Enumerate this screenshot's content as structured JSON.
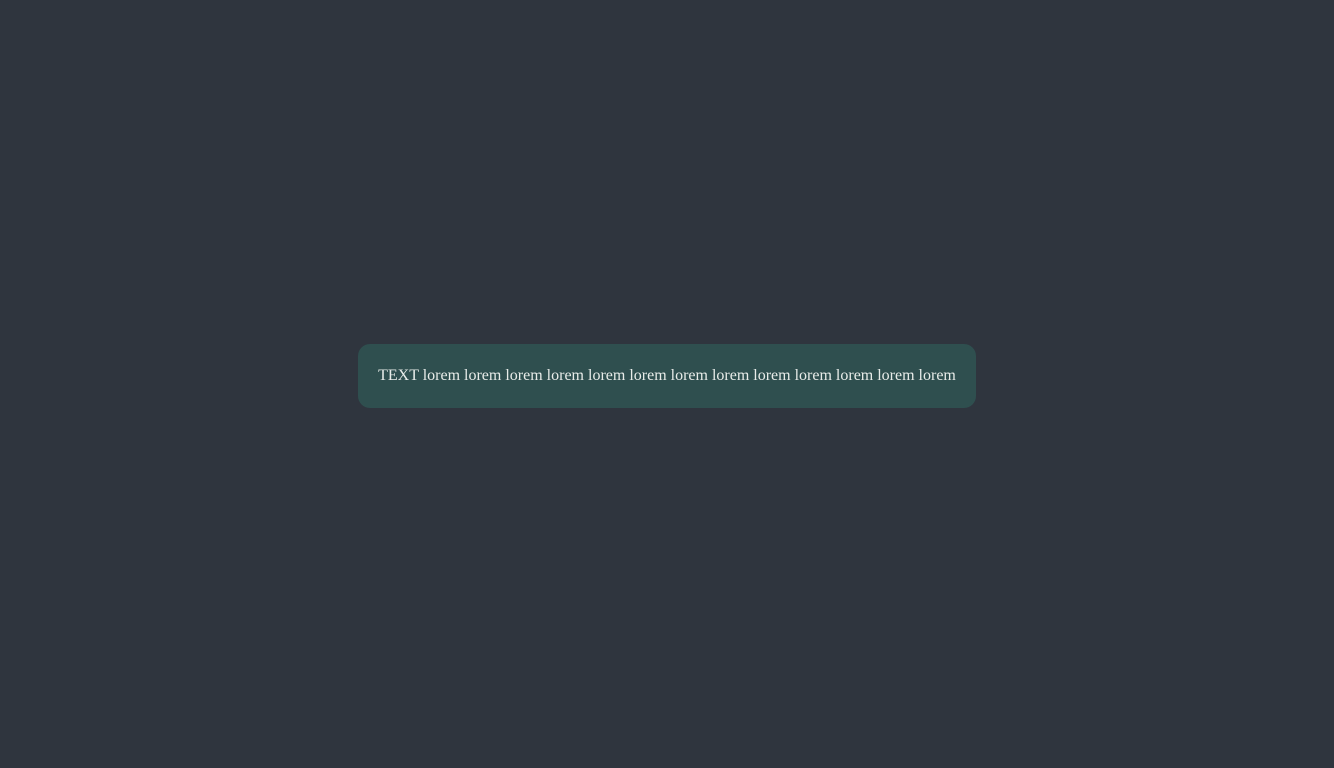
{
  "message": {
    "text": "TEXT lorem lorem lorem lorem lorem lorem lorem lorem lorem lorem lorem lorem lorem"
  },
  "colors": {
    "background": "#2f353e",
    "message_background": "#2f4f4f",
    "message_text": "#e8ece9"
  }
}
